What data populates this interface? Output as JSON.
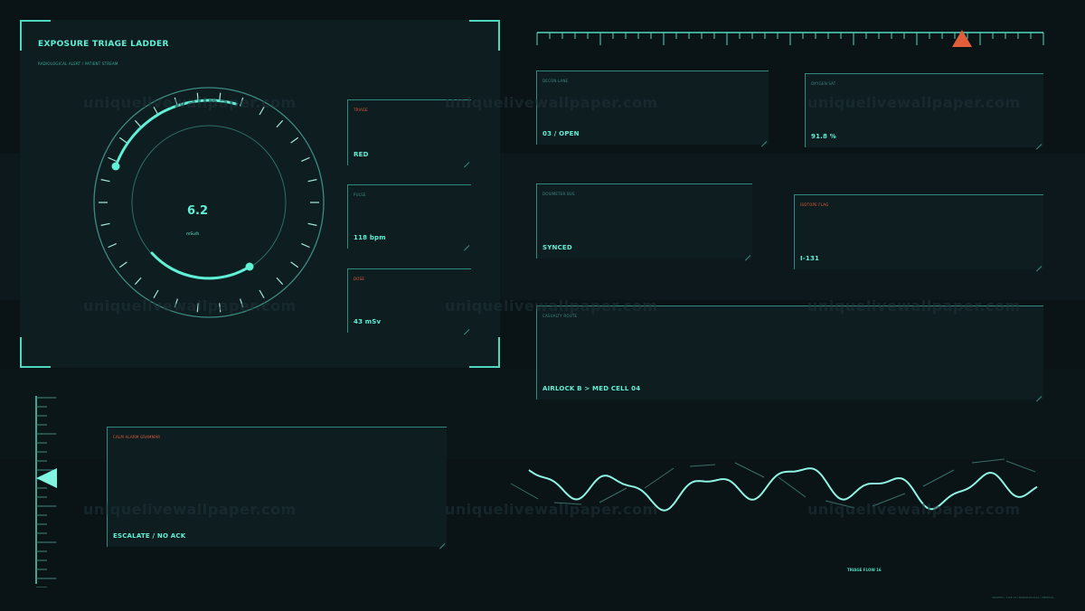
{
  "main_panel": {
    "title": "EXPOSURE TRIAGE LADDER",
    "subtitle": "RADIOLOGICAL ALERT / PATIENT STREAM",
    "dial": {
      "value": "6.2",
      "unit": "mSv/h"
    }
  },
  "side_cards": [
    {
      "label": "TRIAGE",
      "value": "RED",
      "label_color": "red"
    },
    {
      "label": "PULSE",
      "value": "118 bpm",
      "label_color": "dim"
    },
    {
      "label": "DOSE",
      "value": "43 mSv",
      "label_color": "red"
    }
  ],
  "status_cards": [
    {
      "label": "DECON LANE",
      "value": "03 / OPEN",
      "label_color": "dim"
    },
    {
      "label": "OXYGEN SAT",
      "value": "91.8 %",
      "label_color": "dim"
    },
    {
      "label": "DOSIMETER BUS",
      "value": "SYNCED",
      "label_color": "dim"
    },
    {
      "label": "ISOTOPE FLAG",
      "value": "I-131",
      "label_color": "red"
    },
    {
      "label": "CASUALTY ROUTE",
      "value": "AIRLOCK B > MED CELL 04",
      "label_color": "dim"
    }
  ],
  "alarm_card": {
    "label": "CALM ALARM GRAMMAR",
    "value": "ESCALATE / NO ACK"
  },
  "waveform": {
    "label": "TRIAGE FLOW 16"
  },
  "watermark": "uniquelivewallpaper.com",
  "credit": "GRAPHIC / LIVE UI / RADIOLOGICAL / MEDICAL",
  "colors": {
    "accent": "#4fd8c0",
    "bright": "#5ff0d6",
    "alert": "#e25d3a",
    "panel": "#0d1d20",
    "background": "#0a1417"
  }
}
